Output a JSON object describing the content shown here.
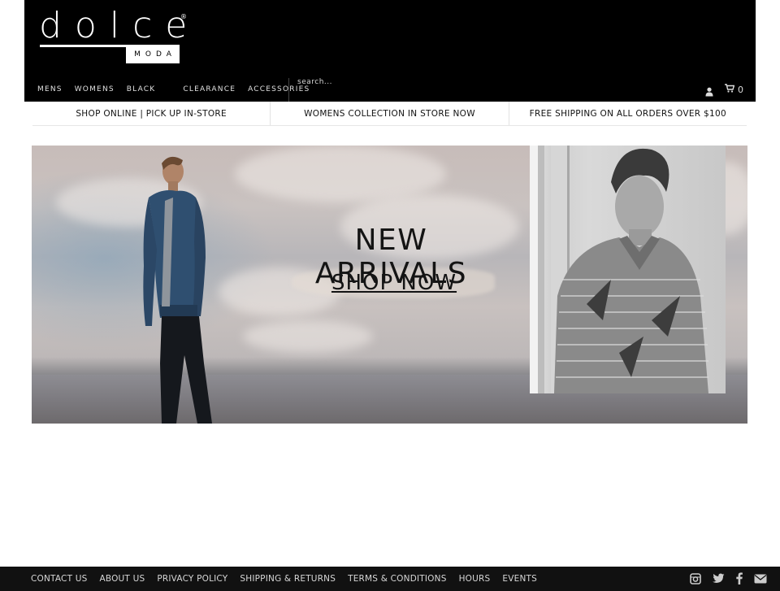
{
  "brand": {
    "wordmark": "dolce",
    "sub": "MODA",
    "registered": "®"
  },
  "nav": {
    "items": [
      "MENS",
      "WOMENS",
      "BLACK",
      "CLEARANCE",
      "ACCESSORIES"
    ],
    "search_placeholder": "search...",
    "cart_count": "0"
  },
  "promo": [
    "SHOP ONLINE | PICK UP IN-STORE",
    "WOMENS COLLECTION IN STORE NOW",
    "FREE SHIPPING ON ALL ORDERS OVER $100"
  ],
  "hero": {
    "title": "NEW ARRIVALS",
    "cta": "SHOP NOW"
  },
  "footer": {
    "links": [
      "CONTACT US",
      "ABOUT US",
      "PRIVACY POLICY",
      "SHIPPING & RETURNS",
      "TERMS & CONDITIONS",
      "HOURS",
      "EVENTS"
    ],
    "social_icons": [
      "instagram-icon",
      "twitter-icon",
      "facebook-icon",
      "email-icon"
    ]
  },
  "colors": {
    "header_bg": "#000000",
    "footer_bg": "#111111",
    "text": "#111111"
  }
}
